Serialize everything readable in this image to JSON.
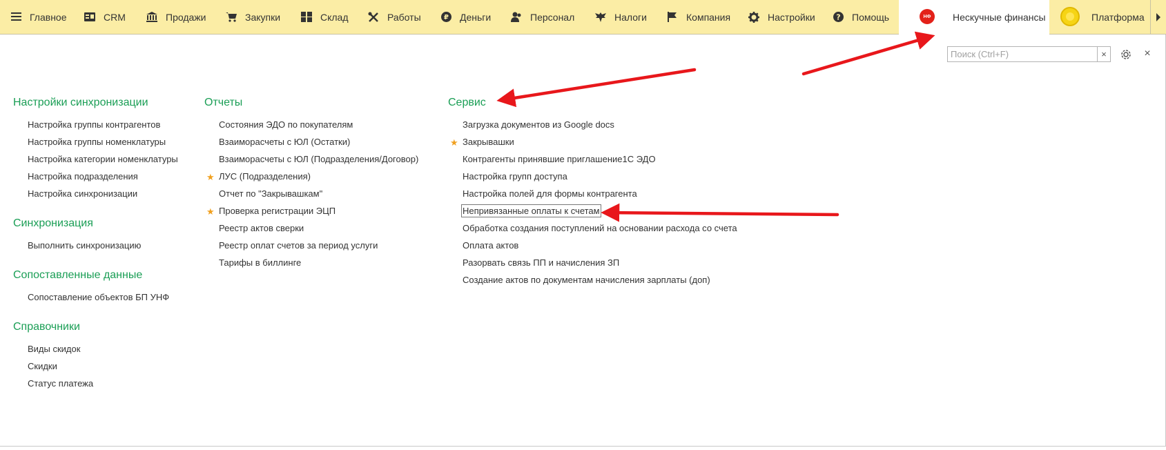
{
  "nav": {
    "items": [
      {
        "label": "Главное",
        "icon": "hamburger-icon"
      },
      {
        "label": "CRM",
        "icon": "crm-icon"
      },
      {
        "label": "Продажи",
        "icon": "bank-icon"
      },
      {
        "label": "Закупки",
        "icon": "cart-icon"
      },
      {
        "label": "Склад",
        "icon": "warehouse-icon"
      },
      {
        "label": "Работы",
        "icon": "tools-icon"
      },
      {
        "label": "Деньги",
        "icon": "ruble-icon"
      },
      {
        "label": "Персонал",
        "icon": "people-icon"
      },
      {
        "label": "Налоги",
        "icon": "eagle-icon"
      },
      {
        "label": "Компания",
        "icon": "flag-icon"
      },
      {
        "label": "Настройки",
        "icon": "gear-icon"
      },
      {
        "label": "Помощь",
        "icon": "help-icon"
      }
    ],
    "active": {
      "label": "Нескучные финансы",
      "logo_text": "НФ",
      "logo_color": "#e32119"
    },
    "platform": {
      "label": "Платформа"
    }
  },
  "search": {
    "placeholder": "Поиск (Ctrl+F)",
    "value": "",
    "clear": "×"
  },
  "close_label": "×",
  "colors": {
    "menubar": "#fbeda5",
    "section_title": "#1a9e55",
    "star": "#f0a01f",
    "arrow": "#e8171b"
  },
  "columns": [
    {
      "sections": [
        {
          "title": "Настройки синхронизации",
          "items": [
            {
              "label": "Настройка группы контрагентов"
            },
            {
              "label": "Настройка группы номенклатуры"
            },
            {
              "label": "Настройка категории номенклатуры"
            },
            {
              "label": "Настройка подразделения"
            },
            {
              "label": "Настройка синхронизации"
            }
          ]
        },
        {
          "title": "Синхронизация",
          "items": [
            {
              "label": "Выполнить синхронизацию"
            }
          ]
        },
        {
          "title": "Сопоставленные данные",
          "items": [
            {
              "label": "Сопоставление объектов БП УНФ"
            }
          ]
        },
        {
          "title": "Справочники",
          "items": [
            {
              "label": "Виды скидок"
            },
            {
              "label": "Скидки"
            },
            {
              "label": "Статус платежа"
            }
          ]
        }
      ]
    },
    {
      "sections": [
        {
          "title": "Отчеты",
          "items": [
            {
              "label": "Состояния ЭДО по покупателям"
            },
            {
              "label": "Взаиморасчеты с ЮЛ (Остатки)"
            },
            {
              "label": "Взаиморасчеты с ЮЛ (Подразделения/Договор)"
            },
            {
              "label": "ЛУС (Подразделения)",
              "favorite": true
            },
            {
              "label": "Отчет по \"Закрывашкам\""
            },
            {
              "label": "Проверка регистрации ЭЦП",
              "favorite": true
            },
            {
              "label": "Реестр актов сверки"
            },
            {
              "label": "Реестр оплат счетов за период услуги"
            },
            {
              "label": "Тарифы в биллинге"
            }
          ]
        }
      ]
    },
    {
      "sections": [
        {
          "title": "Сервис",
          "items": [
            {
              "label": "Загрузка документов из Google docs"
            },
            {
              "label": "Закрывашки",
              "favorite": true
            },
            {
              "label": "Контрагенты принявшие приглашение1С ЭДО"
            },
            {
              "label": "Настройка групп доступа"
            },
            {
              "label": "Настройка полей для формы контрагента"
            },
            {
              "label": "Непривязанные оплаты к счетам",
              "selected": true
            },
            {
              "label": "Обработка создания поступлений на основании расхода со счета"
            },
            {
              "label": "Оплата актов"
            },
            {
              "label": "Разорвать связь ПП и начисления ЗП"
            },
            {
              "label": "Создание актов по документам начисления зарплаты (доп)"
            }
          ]
        }
      ]
    }
  ]
}
